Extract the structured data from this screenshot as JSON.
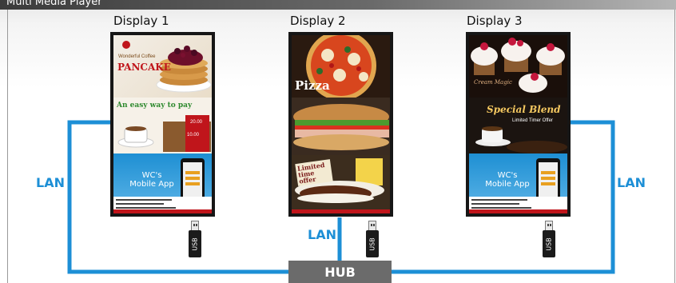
{
  "window": {
    "title": "Multi Media Player"
  },
  "displays": [
    {
      "label": "Display 1",
      "panels": [
        {
          "name": "pancake-promo",
          "small_text": "Wonderful Coffee",
          "headline": "PANCAKE"
        },
        {
          "name": "mobile-pay-promo",
          "headline": "An easy way to pay",
          "price": "10.00",
          "price2": "20.00"
        },
        {
          "name": "mobile-app-promo",
          "headline": "WC's Mobile App"
        }
      ]
    },
    {
      "label": "Display 2",
      "panels": [
        {
          "name": "pizza-promo",
          "headline": "Pizza"
        },
        {
          "name": "sandwich-promo"
        },
        {
          "name": "burger-promo",
          "headline": "Limited time offer"
        }
      ]
    },
    {
      "label": "Display 3",
      "panels": [
        {
          "name": "cupcake-promo",
          "small_text": "Cream Magic"
        },
        {
          "name": "coffee-promo",
          "headline": "Special Blend",
          "subline": "Limited Timer Offer"
        },
        {
          "name": "mobile-app-promo",
          "headline": "WC's Mobile App"
        }
      ]
    }
  ],
  "network": {
    "lan_label": "LAN",
    "hub_label": "HUB",
    "usb_label": "USB",
    "line_color": "#1d8fd6"
  }
}
